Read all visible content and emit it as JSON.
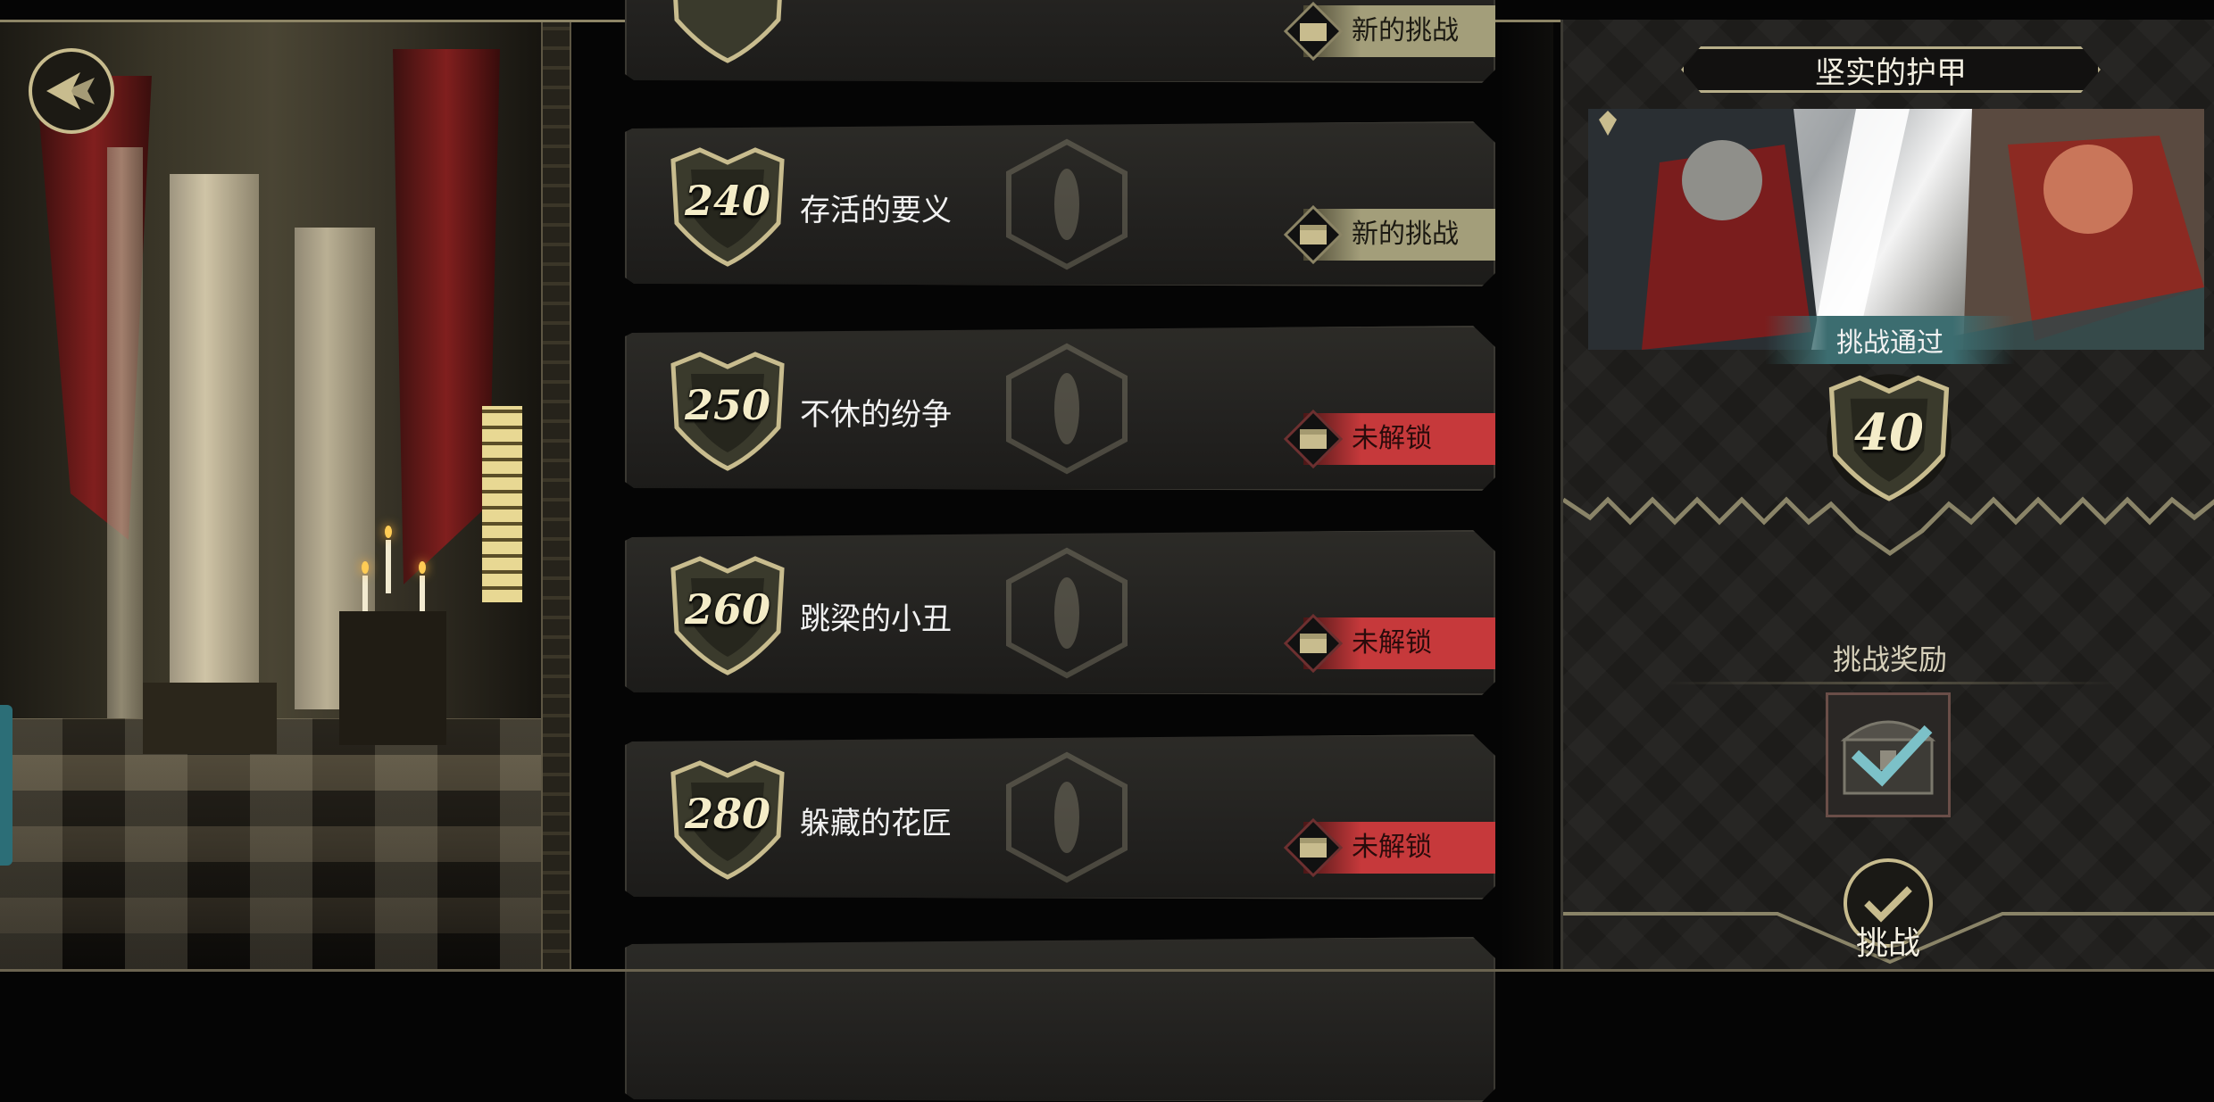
{
  "header": {
    "back_icon": "back-arrow-icon"
  },
  "challenges": [
    {
      "level": "",
      "title": "",
      "status": "新的挑战",
      "state": "new"
    },
    {
      "level": "240",
      "title": "存活的要义",
      "status": "新的挑战",
      "state": "new"
    },
    {
      "level": "250",
      "title": "不休的纷争",
      "status": "未解锁",
      "state": "locked"
    },
    {
      "level": "260",
      "title": "跳梁的小丑",
      "status": "未解锁",
      "state": "locked"
    },
    {
      "level": "280",
      "title": "躲藏的花匠",
      "status": "未解锁",
      "state": "locked"
    },
    {
      "level": "",
      "title": "",
      "status": "",
      "state": "none"
    }
  ],
  "detail": {
    "title": "坚实的护甲",
    "banner": "挑战通过",
    "level": "40",
    "reward_label": "挑战奖励",
    "reward_claimed": true,
    "action_label": "挑战"
  },
  "colors": {
    "gold": "#c8bc8e",
    "new_status": "#a39e7a",
    "locked_status": "#c6393b",
    "banner_teal": "#3c6d70"
  }
}
